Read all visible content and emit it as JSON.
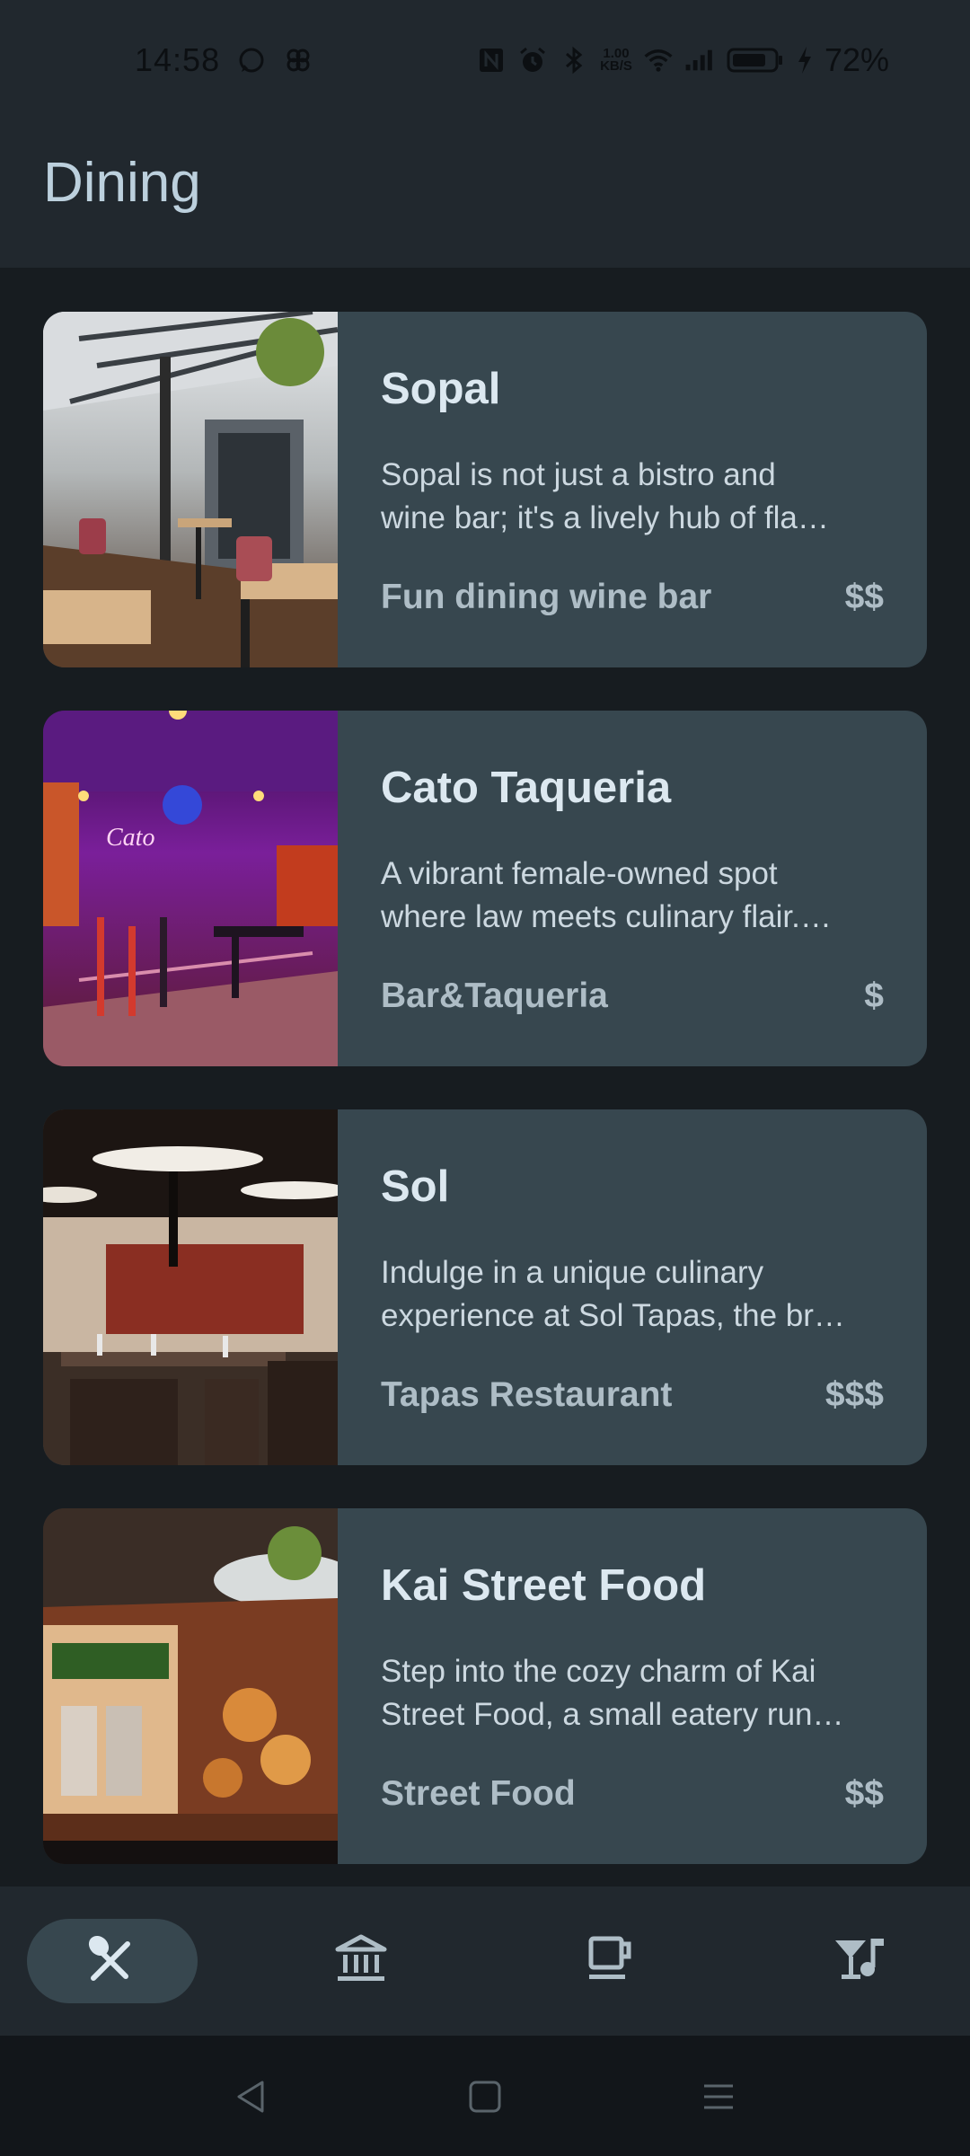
{
  "status_bar": {
    "time": "14:58",
    "net_speed_value": "1.00",
    "net_speed_unit": "KB/S",
    "battery_percent": "72%",
    "icons": [
      "whatsapp-icon",
      "pinwheel-icon",
      "nfc-icon",
      "alarm-icon",
      "bluetooth-icon",
      "wifi-icon",
      "signal-icon",
      "battery-icon",
      "charging-icon"
    ]
  },
  "header": {
    "title": "Dining"
  },
  "restaurants": [
    {
      "name": "Sopal",
      "desc_line1": "Sopal is not just a bistro and",
      "desc_line2": "wine bar; it's a lively hub of fla…",
      "type": "Fun dining wine bar",
      "price": "$$"
    },
    {
      "name": "Cato Taqueria",
      "desc_line1": "A vibrant female-owned spot",
      "desc_line2": "where law meets culinary flair.…",
      "type": "Bar&Taqueria",
      "price": "$"
    },
    {
      "name": "Sol",
      "desc_line1": "Indulge in a unique culinary",
      "desc_line2": "experience at Sol Tapas, the br…",
      "type": "Tapas Restaurant",
      "price": "$$$"
    },
    {
      "name": "Kai Street Food",
      "desc_line1": "Step into the cozy charm of Kai",
      "desc_line2": "Street Food, a small eatery run…",
      "type": "Street Food",
      "price": "$$"
    }
  ],
  "bottom_nav": {
    "items": [
      "dining-icon",
      "museum-icon",
      "cafe-icon",
      "nightlife-icon"
    ],
    "active": "dining-icon"
  },
  "colors": {
    "background": "#171c20",
    "header": "#21282e",
    "card": "#37474f",
    "title_text": "#bcd0dd",
    "muted_text": "#aebdc6"
  }
}
